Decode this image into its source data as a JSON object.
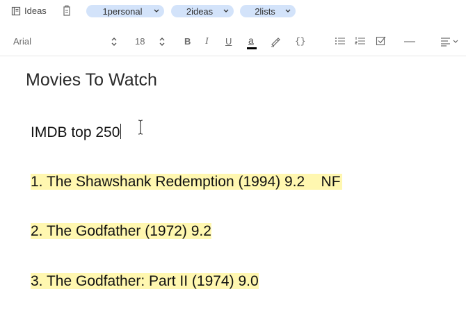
{
  "meta": {
    "notebook_label": "Ideas",
    "tags": [
      {
        "label": "1personal"
      },
      {
        "label": "2ideas"
      },
      {
        "label": "2lists"
      }
    ]
  },
  "toolbar": {
    "font_family": "Arial",
    "font_size": "18",
    "bold_label": "B",
    "italic_label": "I",
    "underline_label": "U",
    "text_color_label": "a",
    "code_label": "{}",
    "icons": [
      "bulleted-list-icon",
      "numbered-list-icon",
      "checklist-icon",
      "divider-icon",
      "align-icon"
    ]
  },
  "note": {
    "title": "Movies To Watch",
    "subheading": "IMDB top 250",
    "items": [
      {
        "text": "1. The Shawshank Redemption (1994) 9.2    NF",
        "highlighted": true
      },
      {
        "text": "2. The Godfather (1972) 9.2",
        "highlighted": true
      },
      {
        "text": "3. The Godfather: Part II (1974) 9.0",
        "highlighted": true
      }
    ]
  },
  "colors": {
    "tag_bg": "#d3e3fa",
    "highlight": "#fff7b0",
    "text_color_swatch": "#000000"
  }
}
